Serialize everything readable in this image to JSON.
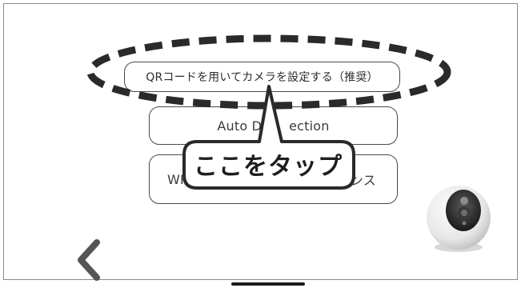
{
  "screen": {
    "options": [
      {
        "label": "QRコードを用いてカメラを設定する（推奨）"
      },
      {
        "label": "Auto Detection",
        "partial": "Auto D",
        "partial_end": "ection"
      },
      {
        "label": "WPS",
        "suffix": "ンス"
      }
    ],
    "callout": {
      "text": "ここをタップ"
    },
    "back_icon": "chevron-left-icon",
    "device_icon": "camera-icon"
  },
  "colors": {
    "border": "#4a4a4a",
    "dash": "#2a2a2a",
    "text": "#3b3b3b",
    "background": "#ffffff"
  }
}
